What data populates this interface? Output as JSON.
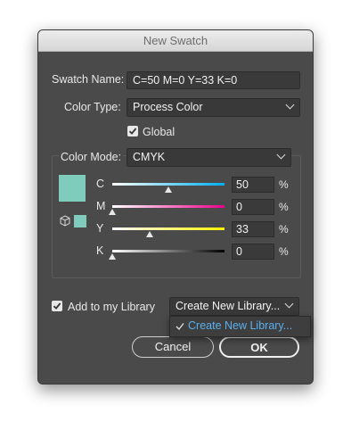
{
  "dialog": {
    "title": "New Swatch",
    "swatch_name_label": "Swatch Name:",
    "swatch_name_value": "C=50 M=0 Y=33 K=0",
    "color_type_label": "Color Type:",
    "color_type_value": "Process Color",
    "global_label": "Global",
    "global_checked": true,
    "color_mode_label": "Color Mode:",
    "color_mode_value": "CMYK",
    "swatch_color": "#80ccbc",
    "sliders": [
      {
        "label": "C",
        "value": "50",
        "unit": "%",
        "colors": [
          "#ffffff",
          "#00aeef"
        ]
      },
      {
        "label": "M",
        "value": "0",
        "unit": "%",
        "colors": [
          "#ffffff",
          "#ec008c"
        ]
      },
      {
        "label": "Y",
        "value": "33",
        "unit": "%",
        "colors": [
          "#ffffff",
          "#fff200"
        ]
      },
      {
        "label": "K",
        "value": "0",
        "unit": "%",
        "colors": [
          "#ffffff",
          "#000000"
        ]
      }
    ],
    "add_to_library_label": "Add to my Library",
    "add_to_library_checked": true,
    "library_select_value": "Create New Library...",
    "library_menu": {
      "items": [
        {
          "label": "Create New Library...",
          "selected": true
        }
      ]
    },
    "cancel_label": "Cancel",
    "ok_label": "OK"
  }
}
